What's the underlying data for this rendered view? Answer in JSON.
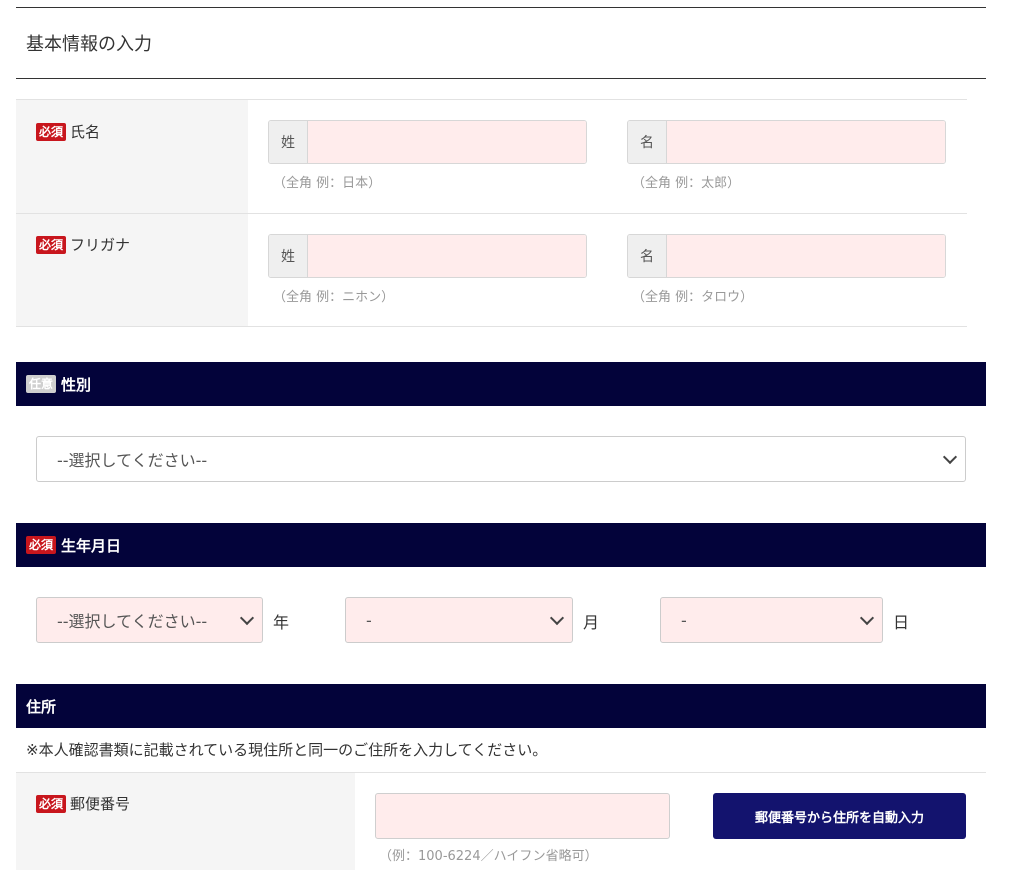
{
  "page": {
    "title": "基本情報の入力"
  },
  "badges": {
    "required": "必須",
    "optional": "任意"
  },
  "name": {
    "label": "氏名",
    "last": {
      "prefix": "姓",
      "hint": "（全角 例：日本）",
      "value": ""
    },
    "first": {
      "prefix": "名",
      "hint": "（全角 例：太郎）",
      "value": ""
    }
  },
  "kana": {
    "label": "フリガナ",
    "last": {
      "prefix": "姓",
      "hint": "（全角 例：ニホン）",
      "value": ""
    },
    "first": {
      "prefix": "名",
      "hint": "（全角 例：タロウ）",
      "value": ""
    }
  },
  "gender": {
    "label": "性別",
    "selected": "--選択してください--"
  },
  "birthdate": {
    "label": "生年月日",
    "year": {
      "selected": "--選択してください--",
      "unit": "年"
    },
    "month": {
      "selected": "-",
      "unit": "月"
    },
    "day": {
      "selected": "-",
      "unit": "日"
    }
  },
  "address": {
    "label": "住所",
    "notice": "※本人確認書類に記載されている現住所と同一のご住所を入力してください。",
    "zip": {
      "label": "郵便番号",
      "value": "",
      "hint": "（例：100-6224／ハイフン省略可）",
      "button_label": "郵便番号から住所を自動入力"
    }
  },
  "icons": {
    "select_arrow": "chevron-down-icon"
  },
  "colors": {
    "navy": "#03033a",
    "required_red": "#c8161d",
    "input_pink": "#ffecec",
    "button_navy": "#13136e"
  }
}
